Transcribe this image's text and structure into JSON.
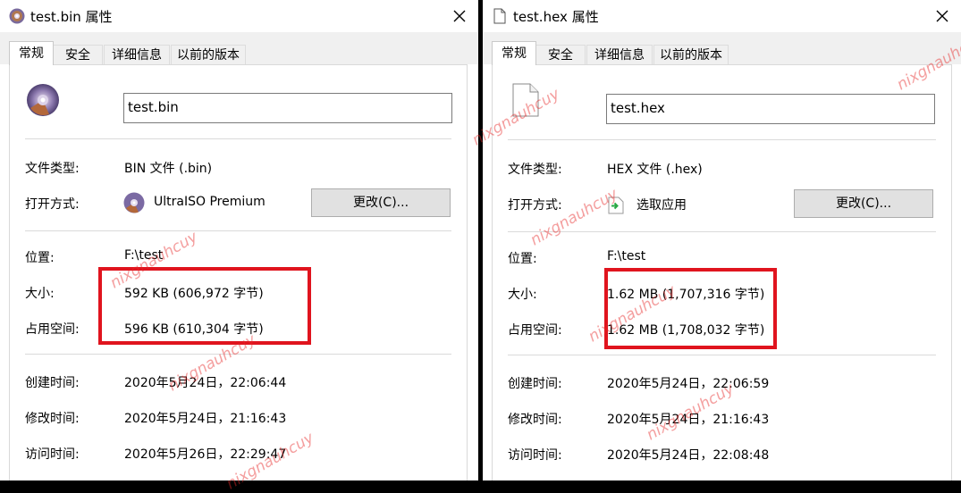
{
  "left": {
    "title": "test.bin 属性",
    "tabs": [
      "常规",
      "安全",
      "详细信息",
      "以前的版本"
    ],
    "filename": "test.bin",
    "labels": {
      "type": "文件类型:",
      "opens_with": "打开方式:",
      "location": "位置:",
      "size": "大小:",
      "size_on_disk": "占用空间:",
      "created": "创建时间:",
      "modified": "修改时间:",
      "accessed": "访问时间:"
    },
    "values": {
      "type": "BIN 文件 (.bin)",
      "opens_with": "UltraISO Premium",
      "location": "F:\\test",
      "size": "592 KB (606,972 字节)",
      "size_on_disk": "596 KB (610,304 字节)",
      "created": "2020年5月24日，22:06:44",
      "modified": "2020年5月24日，21:16:43",
      "accessed": "2020年5月26日，22:29:47"
    },
    "change_button": "更改(C)...",
    "icons": {
      "title": "disc-icon",
      "big": "disc-icon",
      "app": "ultraiso-disc-icon"
    }
  },
  "right": {
    "title": "test.hex 属性",
    "tabs": [
      "常规",
      "安全",
      "详细信息",
      "以前的版本"
    ],
    "filename": "test.hex",
    "labels": {
      "type": "文件类型:",
      "opens_with": "打开方式:",
      "location": "位置:",
      "size": "大小:",
      "size_on_disk": "占用空间:",
      "created": "创建时间:",
      "modified": "修改时间:",
      "accessed": "访问时间:"
    },
    "values": {
      "type": "HEX 文件 (.hex)",
      "opens_with": "选取应用",
      "location": "F:\\test",
      "size": "1.62 MB (1,707,316 字节)",
      "size_on_disk": "1.62 MB (1,708,032 字节)",
      "created": "2020年5月24日，22:06:59",
      "modified": "2020年5月24日，21:16:43",
      "accessed": "2020年5月24日，22:08:48"
    },
    "change_button": "更改(C)...",
    "icons": {
      "title": "blank-file-icon",
      "big": "blank-file-icon",
      "app": "pick-app-icon"
    }
  },
  "watermark": "nixgnauhcuy",
  "colors": {
    "highlight_box": "#e0141e",
    "watermark": "#e62828"
  }
}
